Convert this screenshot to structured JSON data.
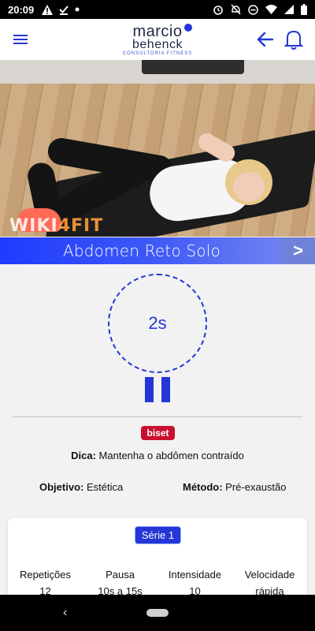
{
  "status_bar": {
    "time": "20:09",
    "left_icons": [
      "warning-icon",
      "download-done-icon",
      "dot-icon"
    ],
    "right_icons": [
      "alarm-icon",
      "notifications-off-icon",
      "do-not-disturb-icon",
      "wifi-icon",
      "signal-icon",
      "battery-icon"
    ]
  },
  "app_bar": {
    "logo_line1": "marcio",
    "logo_line2": "behenck",
    "logo_line3": "CONSULTORIA FITNESS",
    "icons": [
      "menu-icon",
      "back-arrow-icon",
      "bell-icon"
    ],
    "accent": "#2436d6"
  },
  "video": {
    "watermark_part1": "WIKI",
    "watermark_part2": "4FIT"
  },
  "exercise": {
    "title": "Abdomen Reto Solo",
    "next_label": ">",
    "timer_value": "2s",
    "badge": "biset",
    "tip_label": "Dica:",
    "tip_text": "Mantenha o abdômen contraído",
    "objective_label": "Objetivo:",
    "objective_value": "Estética",
    "method_label": "Método:",
    "method_value": "Pré-exaustão"
  },
  "series": {
    "button_label": "Série 1",
    "stats": [
      {
        "label": "Repetições",
        "value": "12"
      },
      {
        "label": "Pausa",
        "value": "10s a 15s"
      },
      {
        "label": "Intensidade",
        "value": "10"
      },
      {
        "label": "Velocidade",
        "value": "rápida"
      }
    ]
  },
  "colors": {
    "primary": "#2436d6",
    "badge": "#c8102e"
  }
}
